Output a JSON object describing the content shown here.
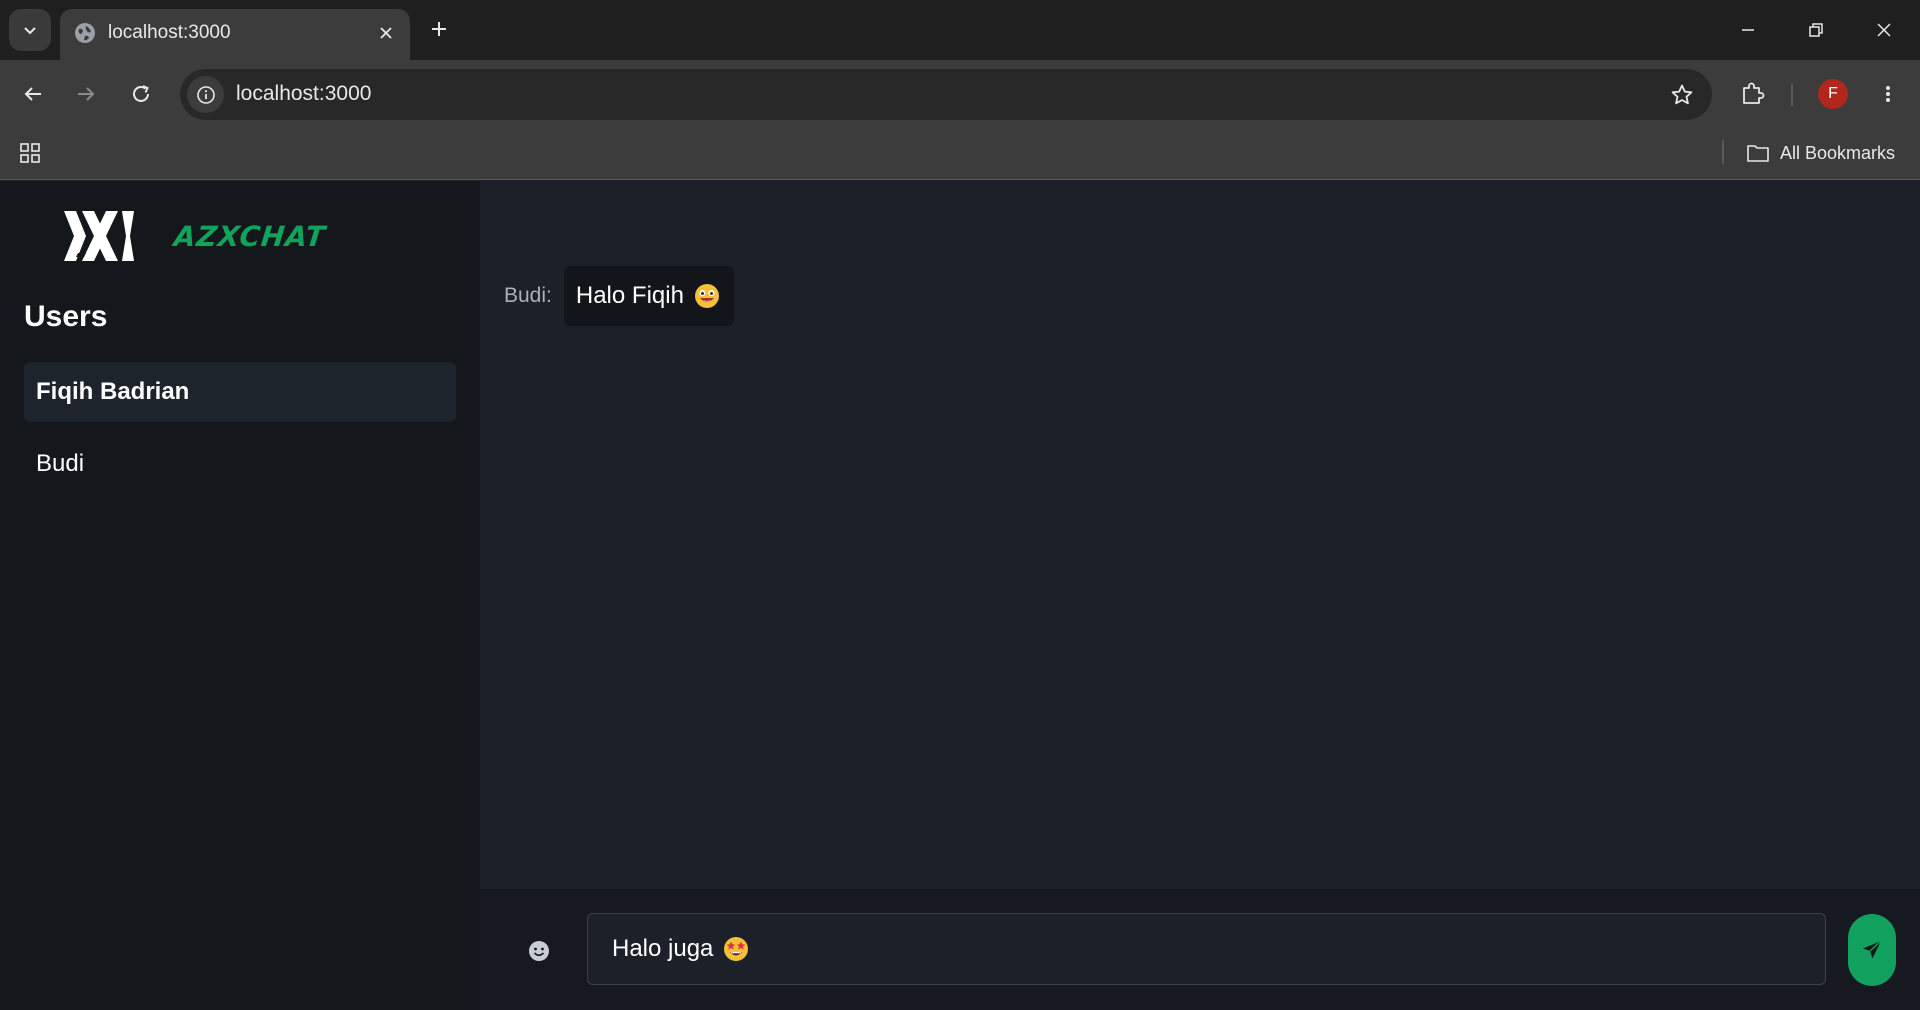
{
  "browser": {
    "tab_title": "localhost:3000",
    "url": "localhost:3000",
    "profile_initial": "F",
    "bookmarks_label": "All Bookmarks"
  },
  "app": {
    "brand_name": "AZXCHAT",
    "users_heading": "Users",
    "users": [
      {
        "name": "Fiqih Badrian",
        "active": true
      },
      {
        "name": "Budi",
        "active": false
      }
    ],
    "messages": [
      {
        "sender": "Budi:",
        "text": "Halo Fiqih",
        "emoji": "grinning-face-emoji"
      }
    ],
    "composer": {
      "value": "Halo juga",
      "emoji": "star-struck-face-emoji"
    },
    "colors": {
      "accent": "#10a35a",
      "sidebar_bg": "#14181d",
      "chat_bg": "#1c2129",
      "avatar": "#b3261e"
    }
  }
}
